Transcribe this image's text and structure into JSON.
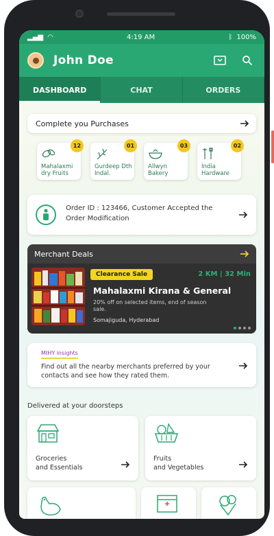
{
  "status_bar": {
    "time": "4:19 AM",
    "battery": "100%"
  },
  "app_bar": {
    "user_name": "John Doe"
  },
  "tabs": [
    {
      "label": "DASHBOARD",
      "active": true
    },
    {
      "label": "CHAT",
      "active": false
    },
    {
      "label": "ORDERS",
      "active": false
    }
  ],
  "complete_purchases": {
    "title": "Complete you Purchases",
    "items": [
      {
        "label": "Mahalaxmi dry Fruits",
        "badge": "12",
        "icon": "nuts-icon"
      },
      {
        "label": "Gurdeep Dth Indal.",
        "badge": "01",
        "icon": "plant-icon"
      },
      {
        "label": "Allwyn Bakery",
        "badge": "03",
        "icon": "bowl-icon"
      },
      {
        "label": "India Hardware",
        "badge": "02",
        "icon": "tools-icon"
      }
    ]
  },
  "order_status": {
    "text": "Order ID : 123466, Customer Accepted the Order Modification"
  },
  "merchant_deals": {
    "title": "Merchant Deals",
    "tag": "Clearance Sale",
    "distance": "2 KM | 32 Min",
    "shop_name": "Mahalaxmi Kirana & General",
    "offer": "20% off on selected items, end of season sale.",
    "location": "Somajiguda, Hyderabad"
  },
  "insights": {
    "title": "MIHY insights",
    "text": "Find out all the nearby merchants preferred by your contacts and see how they rated them."
  },
  "delivered": {
    "title": "Delivered at your doorsteps",
    "tiles": [
      {
        "label_line1": "Groceries",
        "label_line2": "and Essentials",
        "icon": "grocery-store-icon"
      },
      {
        "label_line1": "Fruits",
        "label_line2": "and Vegetables",
        "icon": "fruits-basket-icon"
      },
      {
        "icon": "chicken-icon"
      },
      {
        "icon": "pharmacy-icon"
      },
      {
        "icon": "ice-cream-icon"
      }
    ]
  },
  "colors": {
    "brand_green": "#2aa874",
    "dark_green": "#238d61",
    "badge_yellow": "#f3c81d",
    "deal_bg": "#3d3d3d"
  }
}
